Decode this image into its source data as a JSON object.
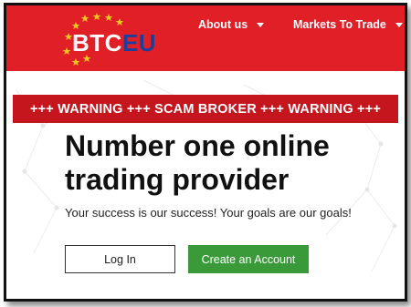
{
  "brand": {
    "logo_part1": "BTC",
    "logo_part2": "EU",
    "logo_text": "BTCEU"
  },
  "nav": {
    "about": "About us",
    "markets": "Markets To Trade"
  },
  "warning_banner": "+++ WARNING +++ SCAM BROKER +++ WARNING +++",
  "hero": {
    "headline_line1": "Number one online",
    "headline_line2": "trading provider",
    "subtext": "Your success is our success! Your goals are our goals!"
  },
  "buttons": {
    "login": "Log In",
    "create_account": "Create an Account"
  },
  "colors": {
    "header_red": "#e11f26",
    "banner_red": "#c4161c",
    "logo_blue": "#1d3f9a",
    "star_yellow": "#f7c51e",
    "create_green": "#3a9a3a"
  },
  "icons": {
    "nav_caret": "chevron-down-icon",
    "logo_stars": "star-icon"
  }
}
